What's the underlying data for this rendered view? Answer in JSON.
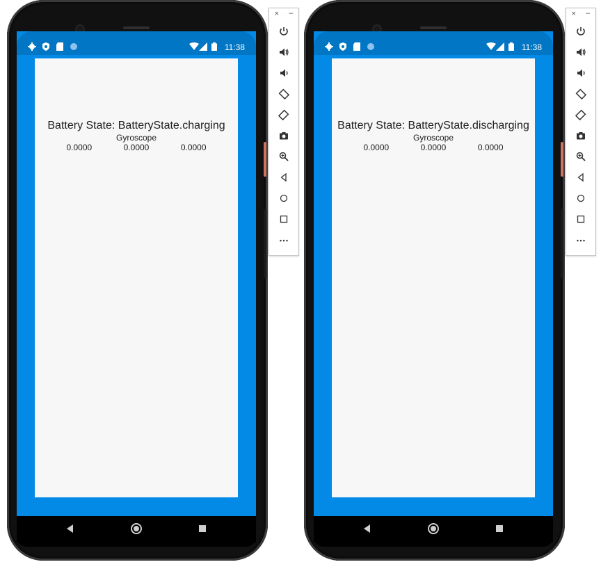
{
  "emulators": [
    {
      "status_bar": {
        "time": "11:38"
      },
      "app": {
        "battery_state": "Battery State: BatteryState.charging",
        "gyro_label": "Gyroscope",
        "gyro_values": [
          "0.0000",
          "0.0000",
          "0.0000"
        ]
      }
    },
    {
      "status_bar": {
        "time": "11:38"
      },
      "app": {
        "battery_state": "Battery State: BatteryState.discharging",
        "gyro_label": "Gyroscope",
        "gyro_values": [
          "0.0000",
          "0.0000",
          "0.0000"
        ]
      }
    }
  ],
  "toolbar": {
    "close_symbol": "×",
    "minimize_symbol": "−",
    "buttons": [
      "power-icon",
      "volume-up-icon",
      "volume-down-icon",
      "rotate-left-icon",
      "rotate-right-icon",
      "camera-icon",
      "zoom-icon",
      "back-icon",
      "home-icon",
      "overview-icon",
      "more-icon"
    ]
  },
  "colors": {
    "screen_blue": "#038ae6",
    "status_bar_blue": "#0076c4",
    "app_background": "#f7f7f7",
    "phone_body": "#111111"
  }
}
